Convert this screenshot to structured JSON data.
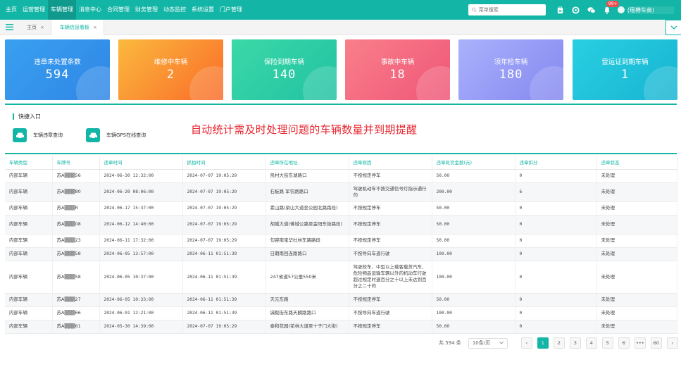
{
  "colors": {
    "brand": "#12b5a6",
    "annotation": "#e8252f"
  },
  "nav": {
    "menu": [
      "主页",
      "运营管理",
      "车辆管理",
      "消息中心",
      "合同管理",
      "财务管理",
      "动态监控",
      "系统设置",
      "门户管理"
    ],
    "search_placeholder": "菜单搜索",
    "badge": "99+",
    "username": "(瑶樽车商)",
    "icons": [
      "clipboard-icon",
      "gear-icon",
      "wechat-icon",
      "bell-icon"
    ]
  },
  "tabs": [
    {
      "label": "主页",
      "close": "×"
    },
    {
      "label": "车辆信息看板",
      "close": "×"
    }
  ],
  "cards": [
    {
      "label": "违章未处置条数",
      "value": "594",
      "color_from": "#39a0f0",
      "color_to": "#2f86e6"
    },
    {
      "label": "维修中车辆",
      "value": "2",
      "color_from": "#fbb93d",
      "color_to": "#f96b29"
    },
    {
      "label": "保险到期车辆",
      "value": "140",
      "color_from": "#3bd8a7",
      "color_to": "#21c2a3"
    },
    {
      "label": "事故中车辆",
      "value": "18",
      "color_from": "#f97f8a",
      "color_to": "#ef5677"
    },
    {
      "label": "须年检车辆",
      "value": "180",
      "color_from": "#aab2fb",
      "color_to": "#8487f0"
    },
    {
      "label": "营运证到期车辆",
      "value": "1",
      "color_from": "#29cfe1",
      "color_to": "#17b4d2"
    }
  ],
  "quick": {
    "title": "快捷入口",
    "links": [
      {
        "label": "车辆违章查询",
        "icon": "car-icon"
      },
      {
        "label": "车辆GPS在线查询",
        "icon": "car-icon"
      }
    ]
  },
  "annotation": "自动统计需及时处理问题的车辆数量并到期提醒",
  "table": {
    "headers": [
      "车辆类型",
      "车牌号",
      "违章时间",
      "抓拍时间",
      "违章所在地址",
      "违章原因",
      "违章处罚金额(元)",
      "违章扣分",
      "违章状态"
    ],
    "rows": [
      [
        "内部车辆",
        "苏A▒▒▒56",
        "2024-06-30 12:32:00",
        "2024-07-07 19:05:29",
        "凯村大街东湖路口",
        "不按规定停车",
        "50.00",
        "0",
        "未处理"
      ],
      [
        "内部车辆",
        "苏A▒▒▒80",
        "2024-06-20 08:06:00",
        "2024-07-07 19:05:29",
        "石板路 军农路路口",
        "驾驶机动车不按交通信号灯指示通行的",
        "200.00",
        "6",
        "未处理"
      ],
      [
        "内部车辆",
        "苏A▒▒▒R",
        "2024-06-17 15:37:00",
        "2024-07-07 19:05:29",
        "素山路(梁山大道至公园北路路段)",
        "不按规定停车",
        "50.00",
        "0",
        "未处理"
      ],
      [
        "内部车辆",
        "苏A▒▒▒08",
        "2024-06-12 14:40:00",
        "2024-07-07 19:05:29",
        "胡城大道(佛城公路至金阳东街路段)",
        "不按规定停车",
        "50.00",
        "0",
        "未处理"
      ],
      [
        "内部车辆",
        "苏A▒▒▒23",
        "2024-06-11 17:32:00",
        "2024-07-07 19:05:29",
        "句容南宝华杜林东路路段",
        "不按规定停车",
        "50.00",
        "0",
        "未处理"
      ],
      [
        "内部车辆",
        "苏A▒▒▒58",
        "2024-06-05 13:57:00",
        "2024-06-11 01:51:39",
        "日期南回连路路口",
        "不按导向车道行驶",
        "100.00",
        "0",
        "未处理"
      ],
      [
        "内部车辆",
        "苏A▒▒▒58",
        "2024-06-05 10:37:00",
        "2024-06-11 01:51:39",
        "247省道57公里550米",
        "驾驶校车、中型以上载客载货汽车、危险物品运输车辆以外的机动车行驶超过规定时速百分之十以上未达到百分之二十的",
        "100.00",
        "0",
        "未处理"
      ],
      [
        "内部车辆",
        "苏A▒▒▒27",
        "2024-06-05 10:33:00",
        "2024-06-11 01:51:39",
        "天元东路",
        "不按规定停车",
        "50.00",
        "0",
        "未处理"
      ],
      [
        "内部车辆",
        "苏A▒▒▒66",
        "2024-06-01 12:21:00",
        "2024-06-11 01:51:39",
        "诚毅街东路天麟路路口",
        "不按导向车道行驶",
        "100.00",
        "0",
        "未处理"
      ],
      [
        "内部车辆",
        "苏A▒▒▒61",
        "2024-05-30 14:39:00",
        "2024-07-07 19:05:29",
        "泰和花园(花林大道至十子门大街)",
        "不按规定停车",
        "50.00",
        "0",
        "未处理"
      ]
    ]
  },
  "pagination": {
    "total": "共 594 条",
    "page_size": "10条/页",
    "pages": [
      "1",
      "2",
      "3",
      "4",
      "5",
      "6",
      "•••",
      "60"
    ],
    "prev": "‹",
    "next": "›"
  }
}
